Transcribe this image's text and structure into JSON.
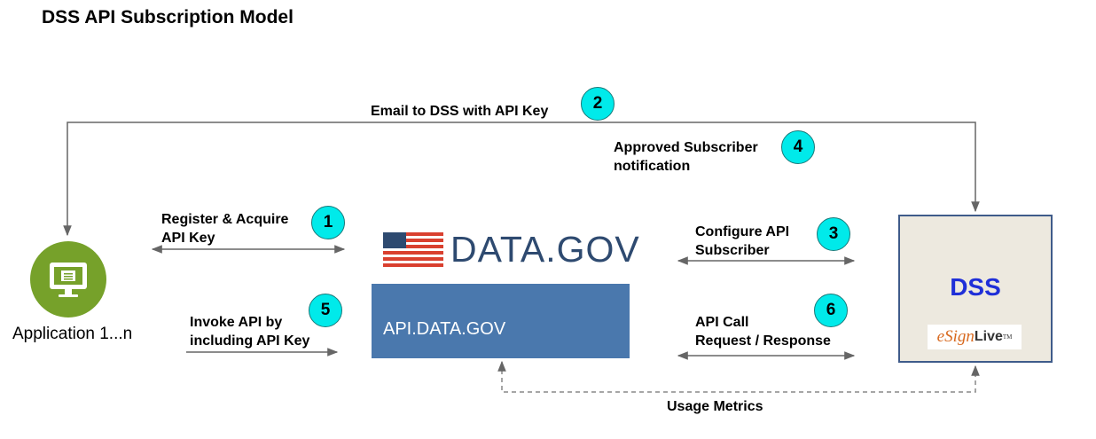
{
  "title": "DSS API Subscription Model",
  "app": {
    "label": "Application 1...n",
    "icon": "computer-monitor-icon"
  },
  "datagov": {
    "logo_text": "DATA.GOV",
    "flag_icon": "us-flag-icon"
  },
  "api_box": {
    "label": "API.DATA.GOV"
  },
  "dss": {
    "label": "DSS",
    "esign_logo": "eSignLive",
    "esign_tm": "TM"
  },
  "steps": [
    {
      "number": "1",
      "lines": [
        "Register & Acquire",
        "API Key"
      ]
    },
    {
      "number": "2",
      "lines": [
        "Email to DSS with API Key"
      ]
    },
    {
      "number": "3",
      "lines": [
        "Configure API",
        "Subscriber"
      ]
    },
    {
      "number": "4",
      "lines": [
        "Approved Subscriber",
        "notification"
      ]
    },
    {
      "number": "5",
      "lines": [
        "Invoke API by",
        "including API Key"
      ]
    },
    {
      "number": "6",
      "lines": [
        "API Call",
        "Request / Response"
      ]
    }
  ],
  "usage_metrics": "Usage Metrics",
  "colors": {
    "badge": "#00eaea",
    "app_icon": "#76a12a",
    "api_box": "#4a78ad",
    "dss_text": "#1f2fd8",
    "dss_box": "#ede9df"
  }
}
